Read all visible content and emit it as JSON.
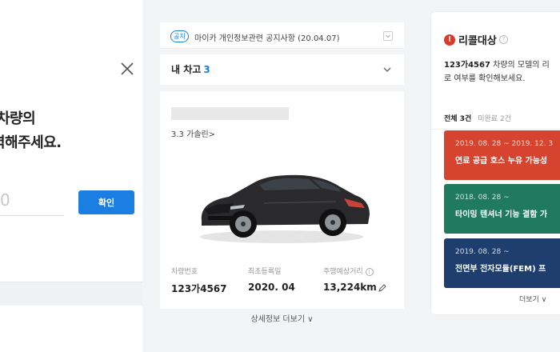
{
  "left": {
    "headline_line1": "차량의",
    "headline_line2": "력해주세요.",
    "input_value": "0",
    "confirm_label": "확인"
  },
  "middle": {
    "notice": {
      "badge": "공지",
      "text": "마이카 개인정보관련 공지사항 (20.04.07)"
    },
    "garage": {
      "label": "내 차고",
      "count": "3"
    },
    "card": {
      "fuel": "3.3 가솔린>",
      "stats": [
        {
          "label": "차량번호",
          "value": "123가4567"
        },
        {
          "label": "최초등록일",
          "value": "2020. 04"
        },
        {
          "label": "주행예상거리",
          "value": "13,224km"
        }
      ],
      "more": "상세정보 더보기"
    }
  },
  "right": {
    "title": "리콜대상",
    "desc_bold": "123가4567",
    "desc_rest1": " 차량의 모델의 리",
    "desc_line2": "로 여부를 확인해보세요.",
    "filter_all": "전체 3건",
    "filter_pending": "미완료 2건",
    "recalls": [
      {
        "date": "2019. 08. 28 ~ 2019. 12. 3",
        "title": "연료 공급 호스 누유 가능성",
        "color": "#d6432f"
      },
      {
        "date": "2018. 08. 28 ~",
        "title": "타이밍 텐셔너 기능 결함 가",
        "color": "#1f7a5e"
      },
      {
        "date": "2019. 08. 28 ~",
        "title": "전면부 전자모듈(FEM) 프",
        "color": "#1e3f6e"
      }
    ],
    "more": "더보기 ∨"
  }
}
